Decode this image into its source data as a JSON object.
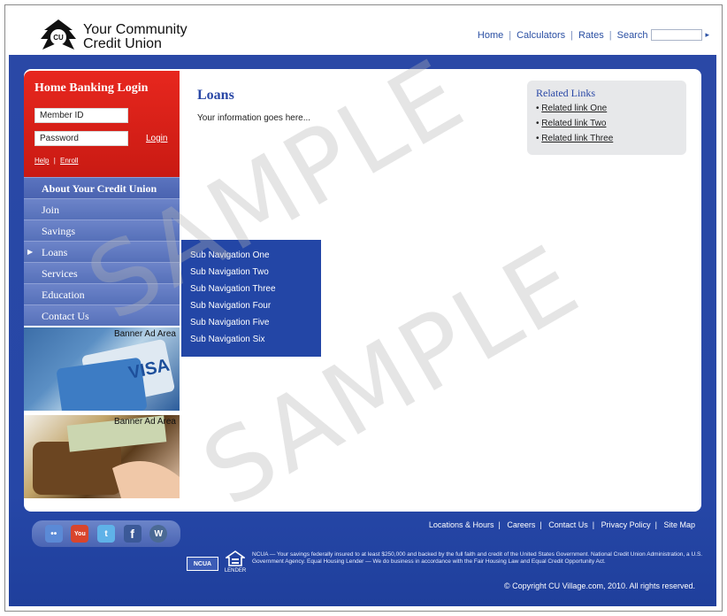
{
  "brand": {
    "line1": "Your Community",
    "line2": "Credit Union",
    "logo_icon": "cu-logo-icon"
  },
  "topnav": {
    "home": "Home",
    "calculators": "Calculators",
    "rates": "Rates",
    "search": "Search",
    "search_placeholder": ""
  },
  "login": {
    "title": "Home Banking Login",
    "member_id": "Member ID",
    "password": "Password",
    "login": "Login",
    "help": "Help",
    "enroll": "Enroll",
    "sep": "|"
  },
  "nav": {
    "items": [
      {
        "label": "About Your Credit Union"
      },
      {
        "label": "Join"
      },
      {
        "label": "Savings"
      },
      {
        "label": "Loans"
      },
      {
        "label": "Services"
      },
      {
        "label": "Education"
      },
      {
        "label": "Contact Us"
      }
    ]
  },
  "subnav": [
    "Sub Navigation One",
    "Sub Navigation Two",
    "Sub Navigation Three",
    "Sub Navigation Four",
    "Sub Navigation Five",
    "Sub Navigation Six"
  ],
  "banners": [
    {
      "label": "Banner Ad Area"
    },
    {
      "label": "Banner Ad Area"
    }
  ],
  "main": {
    "title": "Loans",
    "text": "Your information goes here..."
  },
  "related": {
    "title": "Related Links",
    "links": [
      "Related link One",
      "Related link Two",
      "Related link Three"
    ]
  },
  "social": {
    "flickr": "••",
    "youtube": "You",
    "twitter": "t",
    "facebook": "f",
    "wordpress": "W"
  },
  "footer": {
    "links": [
      "Locations & Hours",
      "Careers",
      "Contact Us",
      "Privacy Policy",
      "Site Map"
    ],
    "ncua": "NCUA",
    "ehl": "LENDER",
    "disclaimer": "NCUA — Your savings federally insured to at least $250,000 and backed by the full faith and credit of the United States Government. National Credit Union Administration, a U.S. Government Agency. Equal Housing Lender — We do business in accordance with the Fair Housing Law and Equal Credit Opportunity Act.",
    "copyright": "© Copyright CU Village.com, 2010. All rights reserved."
  },
  "watermark": "SAMPLE"
}
